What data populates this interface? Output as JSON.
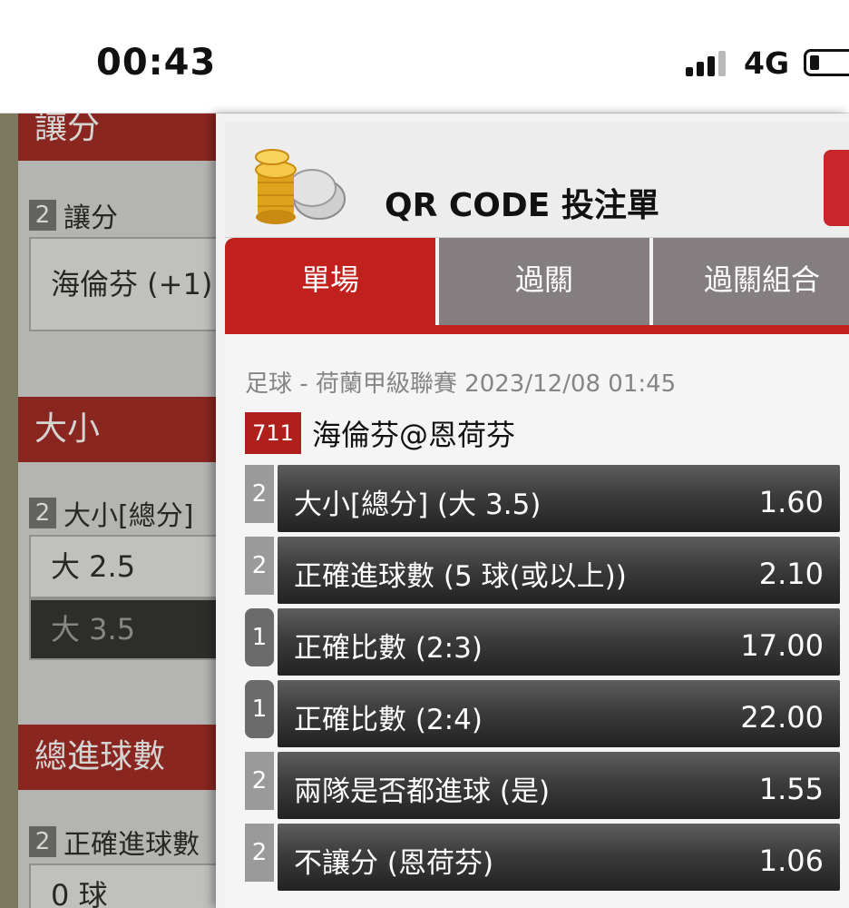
{
  "status_bar": {
    "time": "00:43",
    "network": "4G"
  },
  "background_page": {
    "handicap": {
      "header": "讓分",
      "sub_badge": "2",
      "sub_label": "讓分",
      "option": "海倫芬 (+1)"
    },
    "over_under": {
      "header": "大小",
      "sub_badge": "2",
      "sub_label": "大小[總分]",
      "options": [
        "大 2.5",
        "大 3.5"
      ],
      "selected": "大 3.5"
    },
    "total_goals": {
      "header": "總進球數",
      "sub_badge": "2",
      "sub_label": "正確進球數",
      "option": "0 球"
    }
  },
  "modal": {
    "title": "QR CODE 投注單",
    "tabs": [
      {
        "label": "單場",
        "active": true
      },
      {
        "label": "過關",
        "active": false
      },
      {
        "label": "過關組合",
        "active": false
      }
    ],
    "match_info": "足球 - 荷蘭甲級聯賽 2023/12/08 01:45",
    "match_no": "711",
    "match_name": "海倫芬@恩荷芬",
    "bets": [
      {
        "badge": "2",
        "label": "大小[總分] (大 3.5)",
        "odds": "1.60"
      },
      {
        "badge": "2",
        "label": "正確進球數 (5 球(或以上))",
        "odds": "2.10"
      },
      {
        "badge": "1",
        "label": "正確比數 (2:3)",
        "odds": "17.00"
      },
      {
        "badge": "1",
        "label": "正確比數 (2:4)",
        "odds": "22.00"
      },
      {
        "badge": "2",
        "label": "兩隊是否都進球 (是)",
        "odds": "1.55"
      },
      {
        "badge": "2",
        "label": "不讓分 (恩荷芬)",
        "odds": "1.06"
      }
    ]
  },
  "colors": {
    "brand_red": "#c0211c",
    "tab_inactive": "#847e80",
    "bet_bar_dark": "#333333"
  }
}
